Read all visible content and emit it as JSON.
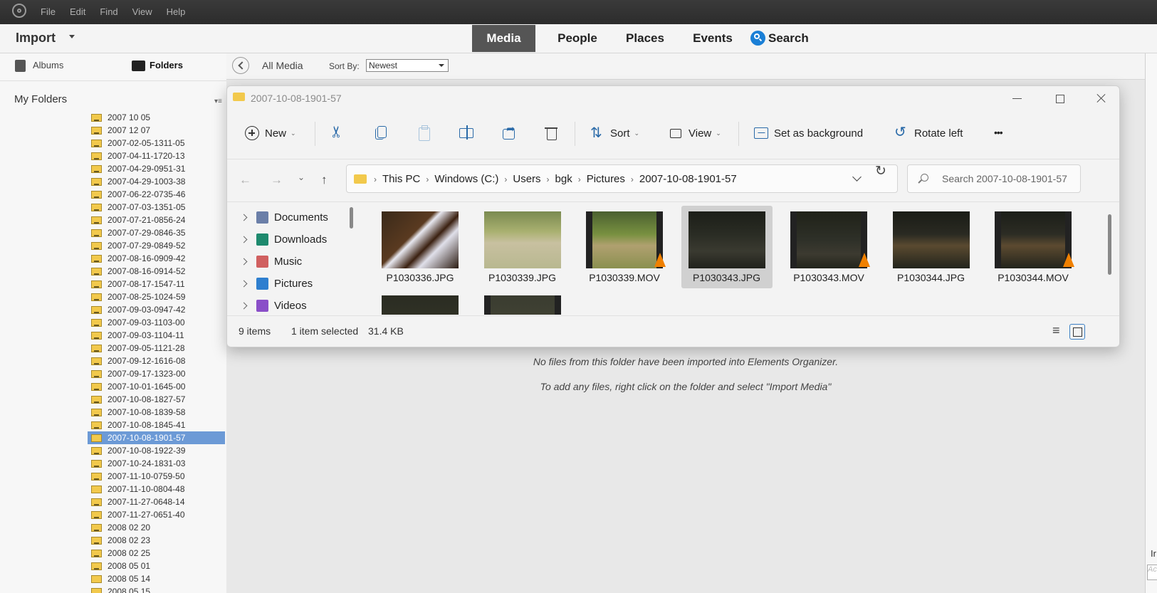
{
  "menubar": [
    "File",
    "Edit",
    "Find",
    "View",
    "Help"
  ],
  "header": {
    "import_label": "Import",
    "tabs": [
      {
        "label": "Media",
        "active": true
      },
      {
        "label": "People",
        "active": false
      },
      {
        "label": "Places",
        "active": false
      },
      {
        "label": "Events",
        "active": false
      }
    ],
    "search_label": "Search"
  },
  "sidebar": {
    "tabs": [
      {
        "label": "Albums"
      },
      {
        "label": "Folders"
      }
    ],
    "section_title": "My Folders",
    "folders": [
      {
        "name": "2007 10 05",
        "photo": true
      },
      {
        "name": "2007 12 07",
        "photo": true
      },
      {
        "name": "2007-02-05-1311-05",
        "photo": true
      },
      {
        "name": "2007-04-11-1720-13",
        "photo": true
      },
      {
        "name": "2007-04-29-0951-31",
        "photo": true
      },
      {
        "name": "2007-04-29-1003-38",
        "photo": true
      },
      {
        "name": "2007-06-22-0735-46",
        "photo": true
      },
      {
        "name": "2007-07-03-1351-05",
        "photo": true
      },
      {
        "name": "2007-07-21-0856-24",
        "photo": true
      },
      {
        "name": "2007-07-29-0846-35",
        "photo": true
      },
      {
        "name": "2007-07-29-0849-52",
        "photo": true
      },
      {
        "name": "2007-08-16-0909-42",
        "photo": true
      },
      {
        "name": "2007-08-16-0914-52",
        "photo": true
      },
      {
        "name": "2007-08-17-1547-11",
        "photo": true
      },
      {
        "name": "2007-08-25-1024-59",
        "photo": true
      },
      {
        "name": "2007-09-03-0947-42",
        "photo": true
      },
      {
        "name": "2007-09-03-1103-00",
        "photo": true
      },
      {
        "name": "2007-09-03-1104-11",
        "photo": true
      },
      {
        "name": "2007-09-05-1121-28",
        "photo": true
      },
      {
        "name": "2007-09-12-1616-08",
        "photo": true
      },
      {
        "name": "2007-09-17-1323-00",
        "photo": true
      },
      {
        "name": "2007-10-01-1645-00",
        "photo": true
      },
      {
        "name": "2007-10-08-1827-57",
        "photo": true
      },
      {
        "name": "2007-10-08-1839-58",
        "photo": true
      },
      {
        "name": "2007-10-08-1845-41",
        "photo": true
      },
      {
        "name": "2007-10-08-1901-57",
        "photo": false,
        "selected": true
      },
      {
        "name": "2007-10-08-1922-39",
        "photo": true
      },
      {
        "name": "2007-10-24-1831-03",
        "photo": true
      },
      {
        "name": "2007-11-10-0759-50",
        "photo": true
      },
      {
        "name": "2007-11-10-0804-48",
        "photo": false
      },
      {
        "name": "2007-11-27-0648-14",
        "photo": true
      },
      {
        "name": "2007-11-27-0651-40",
        "photo": true
      },
      {
        "name": "2008 02 20",
        "photo": true
      },
      {
        "name": "2008 02 23",
        "photo": true
      },
      {
        "name": "2008 02 25",
        "photo": true
      },
      {
        "name": "2008 05 01",
        "photo": true
      },
      {
        "name": "2008 05 14",
        "photo": false
      },
      {
        "name": "2008 05 15",
        "photo": true
      }
    ]
  },
  "content": {
    "back_label": "All Media",
    "sort_by_label": "Sort By:",
    "sort_value": "Newest",
    "empty_line1": "No files from this folder have been imported into Elements Organizer.",
    "empty_line2": "To add any files, right click on the folder and select \"Import Media\"",
    "right_strip_text": "Ir",
    "right_strip_box": "Ac"
  },
  "explorer": {
    "title": "2007-10-08-1901-57",
    "toolbar": {
      "new_label": "New",
      "sort_label": "Sort",
      "view_label": "View",
      "set_background_label": "Set as background",
      "rotate_left_label": "Rotate left"
    },
    "breadcrumb": [
      "This PC",
      "Windows (C:)",
      "Users",
      "bgk",
      "Pictures",
      "2007-10-08-1901-57"
    ],
    "search_placeholder": "Search 2007-10-08-1901-57",
    "nav_items": [
      {
        "label": "Documents",
        "icon": "documents-icon",
        "color": "#6b7fa8"
      },
      {
        "label": "Downloads",
        "icon": "downloads-icon",
        "color": "#1e8a6e"
      },
      {
        "label": "Music",
        "icon": "music-icon",
        "color": "#d06060"
      },
      {
        "label": "Pictures",
        "icon": "pictures-icon",
        "color": "#2f7fcf"
      },
      {
        "label": "Videos",
        "icon": "videos-icon",
        "color": "#8a4fc8"
      }
    ],
    "files": [
      {
        "name": "P1030336.JPG",
        "video": false,
        "selected": false,
        "bg": "linear-gradient(135deg,#3a2a1a 0%,#5a3a20 40%,#e8e8f0 45%,#3a2010 60%,#e0e0ea 70%,#2a1a10 100%)"
      },
      {
        "name": "P1030339.JPG",
        "video": false,
        "selected": false,
        "bg": "linear-gradient(180deg,#7a8a50 0%,#a9b070 35%,#c8c0a0 55%,#b8b890 100%)"
      },
      {
        "name": "P1030339.MOV",
        "video": true,
        "selected": false,
        "bg": "linear-gradient(180deg,#4a6030 0%,#789040 40%,#b0a070 60%,#8a9050 100%)"
      },
      {
        "name": "P1030343.JPG",
        "video": false,
        "selected": true,
        "bg": "linear-gradient(180deg,#1c1e18 0%,#2a2c24 40%,#3a3a30 70%,#20221c 100%)"
      },
      {
        "name": "P1030343.MOV",
        "video": true,
        "selected": false,
        "bg": "linear-gradient(180deg,#202218 0%,#2e3028 50%,#3c3a30 75%,#22241c 100%)"
      },
      {
        "name": "P1030344.JPG",
        "video": false,
        "selected": false,
        "bg": "linear-gradient(180deg,#1a1c16 0%,#2a2a22 40%,#5a4a30 60%,#22241c 100%)"
      },
      {
        "name": "P1030344.MOV",
        "video": true,
        "selected": false,
        "bg": "linear-gradient(180deg,#1c1e18 0%,#2c2c24 40%,#5c4a30 60%,#22241c 100%)"
      },
      {
        "name": "",
        "video": false,
        "selected": false,
        "bg": "linear-gradient(180deg,#2a2c22 0%,#3a3a2c 100%)"
      },
      {
        "name": "",
        "video": true,
        "selected": false,
        "bg": "linear-gradient(180deg,#3a3c30 0%,#4a4a38 100%)"
      }
    ],
    "status": {
      "items": "9 items",
      "selected": "1 item selected",
      "size": "31.4 KB"
    }
  }
}
